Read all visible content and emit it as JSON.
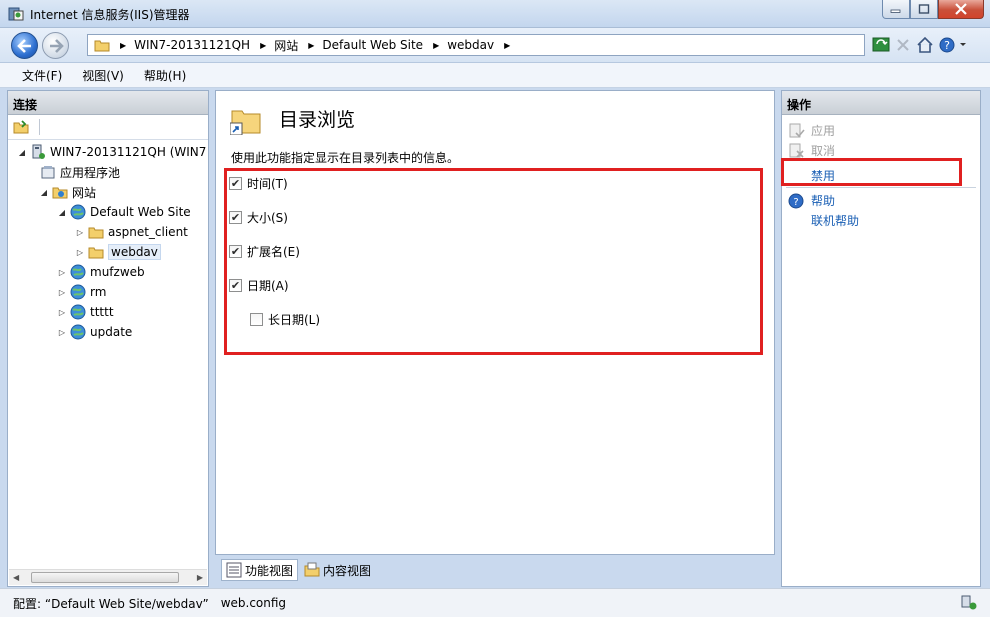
{
  "window": {
    "title": "Internet 信息服务(IIS)管理器"
  },
  "breadcrumb": [
    "WIN7-20131121QH",
    "网站",
    "Default Web Site",
    "webdav"
  ],
  "menu": [
    "文件(F)",
    "视图(V)",
    "帮助(H)"
  ],
  "connections": {
    "header": "连接",
    "tree": [
      {
        "label": "WIN7-20131121QH (WIN7",
        "icon": "server-icon"
      },
      {
        "label": "应用程序池",
        "icon": "app-pool-icon"
      },
      {
        "label": "网站",
        "icon": "sites-folder-icon"
      },
      {
        "label": "Default Web Site",
        "icon": "globe-icon"
      },
      {
        "label": "aspnet_client",
        "icon": "folder-icon"
      },
      {
        "label": "webdav",
        "icon": "folder-icon",
        "selected": true
      },
      {
        "label": "mufzweb",
        "icon": "globe-icon"
      },
      {
        "label": "rm",
        "icon": "globe-icon"
      },
      {
        "label": "ttttt",
        "icon": "globe-icon"
      },
      {
        "label": "update",
        "icon": "globe-icon"
      }
    ]
  },
  "feature": {
    "title": "目录浏览",
    "description": "使用此功能指定显示在目录列表中的信息。",
    "options": [
      {
        "label": "时间(T)",
        "checked": true
      },
      {
        "label": "大小(S)",
        "checked": true
      },
      {
        "label": "扩展名(E)",
        "checked": true
      },
      {
        "label": "日期(A)",
        "checked": true
      },
      {
        "label": "长日期(L)",
        "checked": false
      }
    ]
  },
  "view_tabs": {
    "features": "功能视图",
    "content": "内容视图"
  },
  "actions": {
    "header": "操作",
    "apply": "应用",
    "cancel": "取消",
    "disable": "禁用",
    "help": "帮助",
    "online_help": "联机帮助"
  },
  "status": {
    "config_label": "配置: “Default Web Site/webdav”",
    "file": "web.config"
  },
  "colors": {
    "highlight_red": "#e02020",
    "link_blue": "#1a5fb4"
  }
}
